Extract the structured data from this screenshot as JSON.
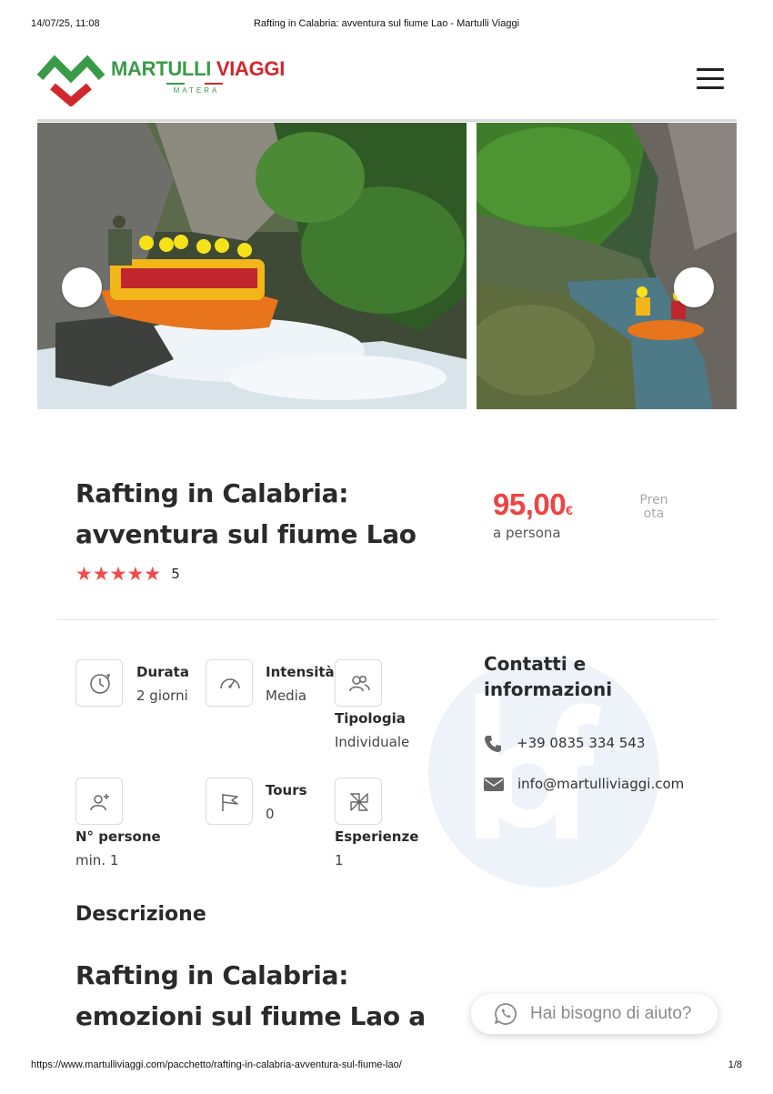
{
  "print_header": {
    "datetime": "14/07/25, 11:08",
    "title": "Rafting in Calabria: avventura sul fiume Lao - Martulli Viaggi"
  },
  "print_footer": {
    "url": "https://www.martulliviaggi.com/pacchetto/rafting-in-calabria-avventura-sul-fiume-lao/",
    "page": "1/8"
  },
  "logo": {
    "name_part1": "MARTULLI",
    "name_part2": "VIAGGI",
    "place": "MATERA"
  },
  "colors": {
    "brand_green": "#3a9b47",
    "brand_red": "#d0272e",
    "price_accent": "#ee4444",
    "star": "#f24a4a"
  },
  "gallery": {
    "prev_icon": "chevron-left-icon",
    "next_icon": "chevron-right-icon"
  },
  "product": {
    "title": "Rafting in Calabria: avventura sul fiume Lao",
    "stars": "★★★★★",
    "rating": "5",
    "price": "95,00",
    "currency": "€",
    "price_unit": "a persona",
    "book_label": "Prenota"
  },
  "features": [
    {
      "icon": "clock-icon",
      "label": "Durata",
      "value": "2 giorni"
    },
    {
      "icon": "speedometer-icon",
      "label": "Intensità",
      "value": "Media"
    },
    {
      "icon": "users-icon",
      "label": "Tipologia",
      "value": "Individuale"
    },
    {
      "icon": "user-plus-icon",
      "label": "N° persone",
      "value": "min. 1"
    },
    {
      "icon": "flag-icon",
      "label": "Tours",
      "value": "0"
    },
    {
      "icon": "pinwheel-icon",
      "label": "Esperienze",
      "value": "1"
    }
  ],
  "contacts": {
    "title": "Contatti e informazioni",
    "phone_icon": "phone-icon",
    "phone": "+39 0835 334 543",
    "email_icon": "envelope-icon",
    "email": "info@martulliviaggi.com"
  },
  "description": {
    "heading": "Descrizione",
    "content_heading": "Rafting in Calabria: emozioni sul fiume Lao a"
  },
  "help_widget": {
    "icon": "whatsapp-icon",
    "label": "Hai bisogno di aiuto?"
  }
}
